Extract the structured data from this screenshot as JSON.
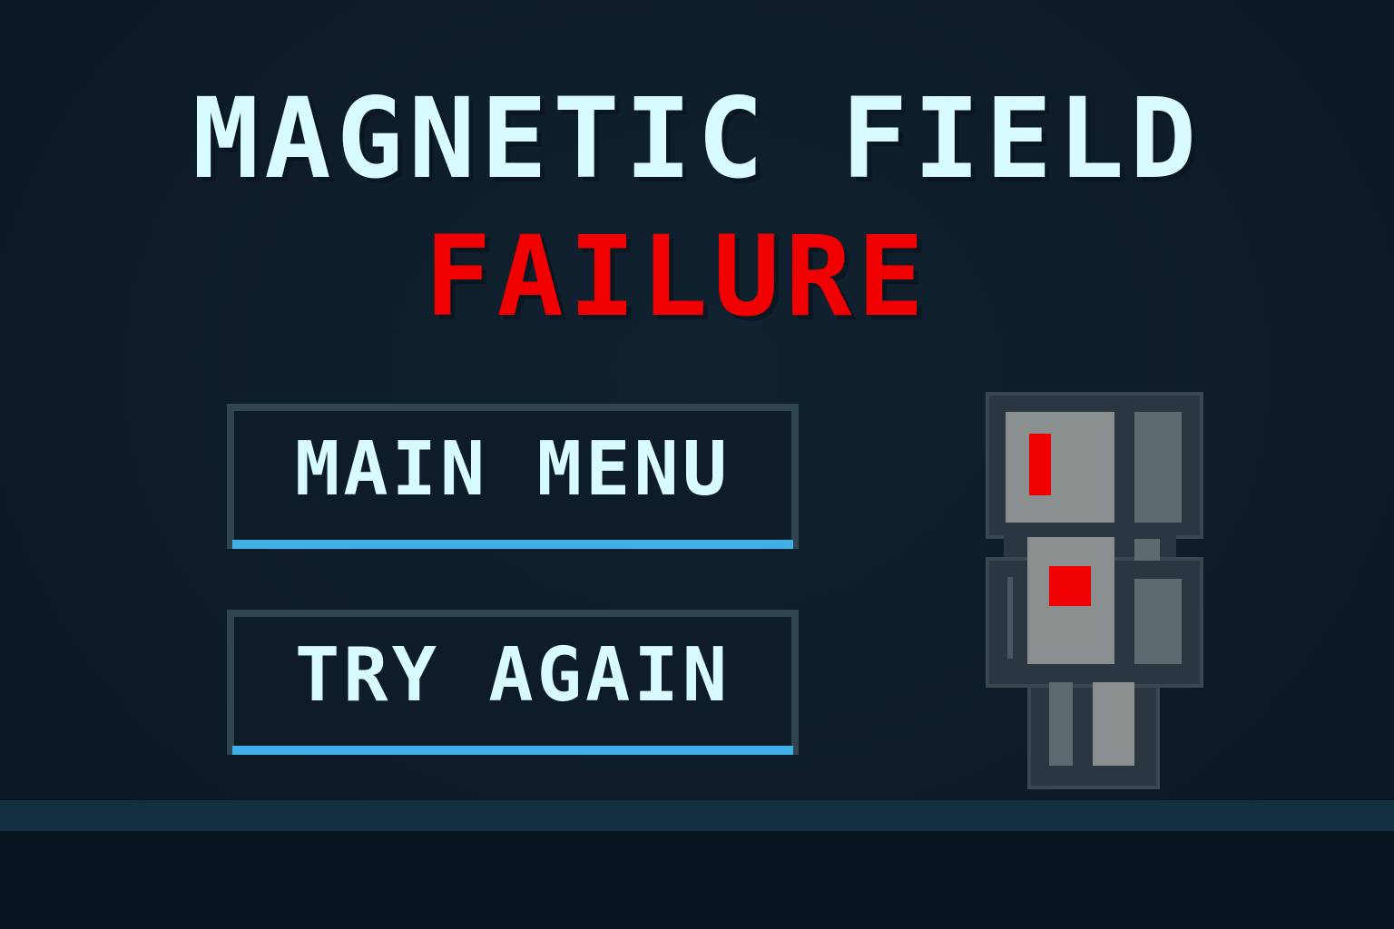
{
  "screen": "game-over",
  "title": {
    "line1": "MAGNETIC FIELD",
    "line2": "FAILURE"
  },
  "menu": {
    "main_menu_label": "MAIN MENU",
    "try_again_label": "TRY AGAIN"
  },
  "colors": {
    "background": "#0d1c28",
    "title_primary": "#d8fbff",
    "title_failure": "#f00000",
    "button_border": "#2f4550",
    "button_accent": "#3fb0e8",
    "robot_gray": "#8a9090",
    "robot_indicator": "#f00000",
    "floor": "#143040"
  },
  "character": {
    "icon": "broken-robot-icon",
    "indicators": "red"
  }
}
